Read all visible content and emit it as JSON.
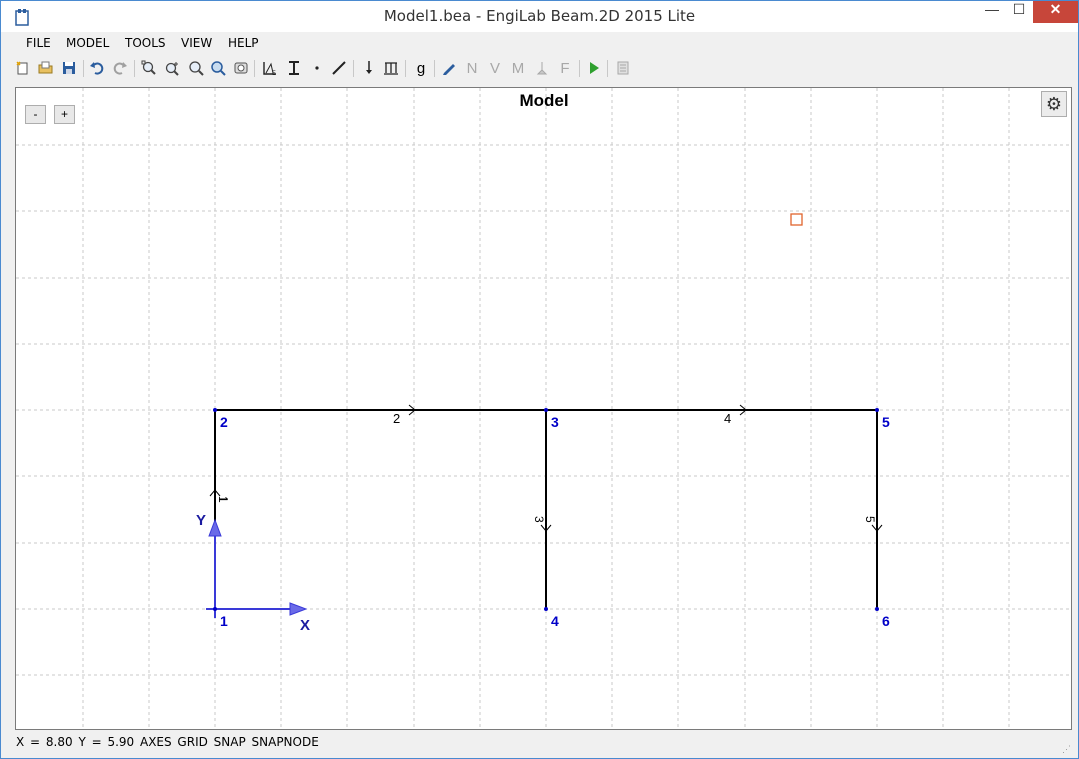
{
  "window": {
    "title": "Model1.bea - EngiLab Beam.2D 2015 Lite",
    "min_symbol": "—",
    "max_symbol": "☐",
    "close_symbol": "✕"
  },
  "menu": {
    "items": [
      {
        "label": "FILE"
      },
      {
        "label": "MODEL"
      },
      {
        "label": "TOOLS"
      },
      {
        "label": "VIEW"
      },
      {
        "label": "HELP"
      }
    ]
  },
  "toolbar": {
    "icons": [
      "new-file-icon",
      "open-file-icon",
      "save-icon",
      "undo-icon",
      "redo-icon",
      "zoom-extents-icon",
      "zoom-in-icon",
      "zoom-window-icon",
      "zoom-realtime-icon",
      "pan-icon",
      "materials-icon",
      "sections-icon",
      "node-icon",
      "element-icon",
      "nodal-load-icon",
      "distributed-load-icon",
      "self-weight-icon",
      "draw-icon",
      "axial-force-icon",
      "shear-force-icon",
      "moment-icon",
      "reactions-icon",
      "deformed-icon",
      "run-icon",
      "report-icon"
    ],
    "g_label": "g",
    "n_label": "N",
    "v_label": "V",
    "m_label": "M",
    "f_label": "F"
  },
  "canvas": {
    "title": "Model",
    "zoom_out_label": "-",
    "zoom_in_label": "+",
    "axis_x_label": "X",
    "axis_y_label": "Y",
    "colors": {
      "grid": "#c8c8c8",
      "element": "#000000",
      "node_label": "#0000c8",
      "axis": "#3a3ad8",
      "cursor_marker": "#e0642d"
    },
    "nodes": [
      {
        "id": "1"
      },
      {
        "id": "2"
      },
      {
        "id": "3"
      },
      {
        "id": "4"
      },
      {
        "id": "5"
      },
      {
        "id": "6"
      }
    ],
    "elements": [
      {
        "id": "1"
      },
      {
        "id": "2"
      },
      {
        "id": "3"
      },
      {
        "id": "4"
      },
      {
        "id": "5"
      }
    ]
  },
  "status": {
    "text": "X = 8.80  Y = 5.90  AXES  GRID  SNAP  SNAPNODE"
  }
}
